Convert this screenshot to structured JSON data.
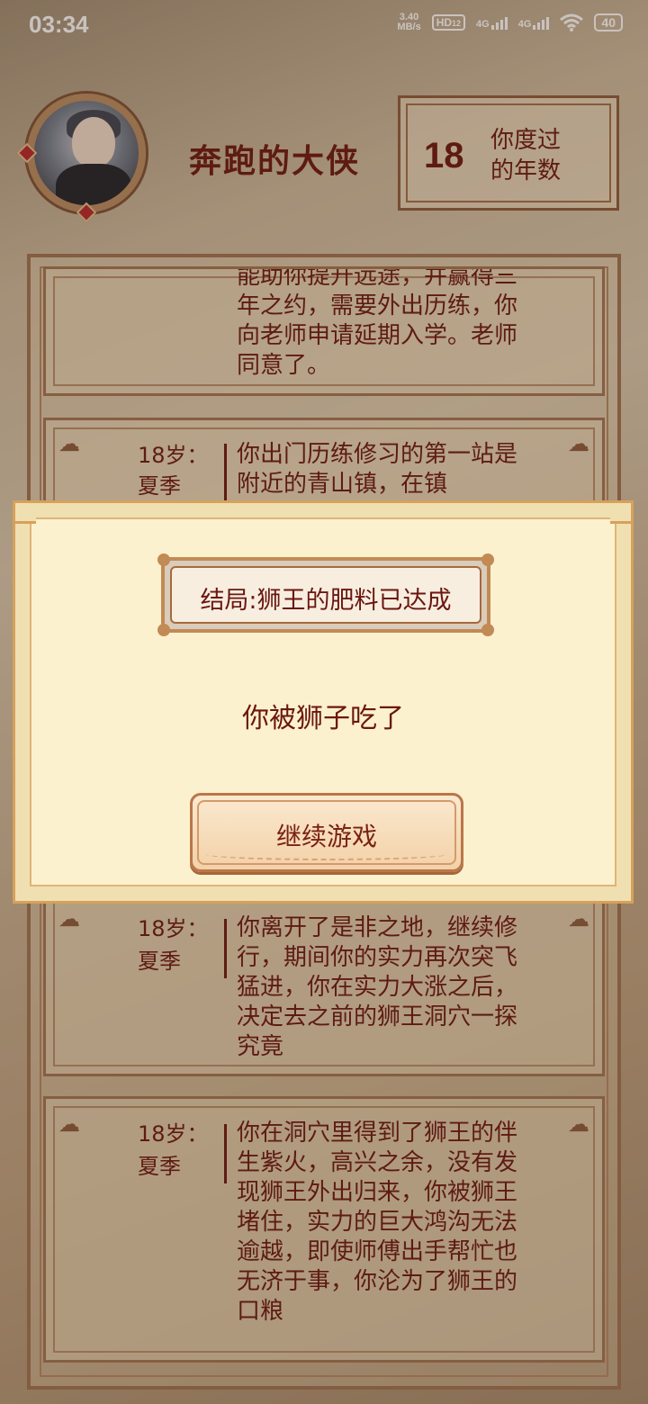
{
  "status_bar": {
    "time": "03:34",
    "net_speed_value": "3.40",
    "net_speed_unit": "MB/s",
    "hd_badge": "HD",
    "hd_sub": "12",
    "signal1": "4G",
    "signal2": "4G",
    "battery": "40"
  },
  "header": {
    "player_name": "奔跑的大侠",
    "years_value": "18",
    "years_label": "你度过的年数"
  },
  "log": {
    "entries": [
      {
        "age": "",
        "season": "",
        "text": "能助你提升远途，并赢得三年之约，需要外出历练，你向老师申请延期入学。老师同意了。"
      },
      {
        "age": "18岁：",
        "season": "夏季",
        "text": "你出门历练修习的第一站是附近的青山镇，在镇"
      },
      {
        "age": "18岁：",
        "season": "夏季",
        "text": "你离开了是非之地，继续修行，期间你的实力再次突飞猛进，你在实力大涨之后，决定去之前的狮王洞穴一探究竟"
      },
      {
        "age": "18岁：",
        "season": "夏季",
        "text": "你在洞穴里得到了狮王的伴生紫火，高兴之余，没有发现狮王外出归来，你被狮王堵住，实力的巨大鸿沟无法逾越，即使师傅出手帮忙也无济于事，你沦为了狮王的口粮"
      }
    ]
  },
  "dialog": {
    "ending_title": "结局:狮王的肥料已达成",
    "ending_description": "你被狮子吃了",
    "continue_label": "继续游戏"
  },
  "colors": {
    "text_primary": "#6b1710",
    "border_brown": "#a37453",
    "dialog_bg": "#fcf1cf"
  }
}
